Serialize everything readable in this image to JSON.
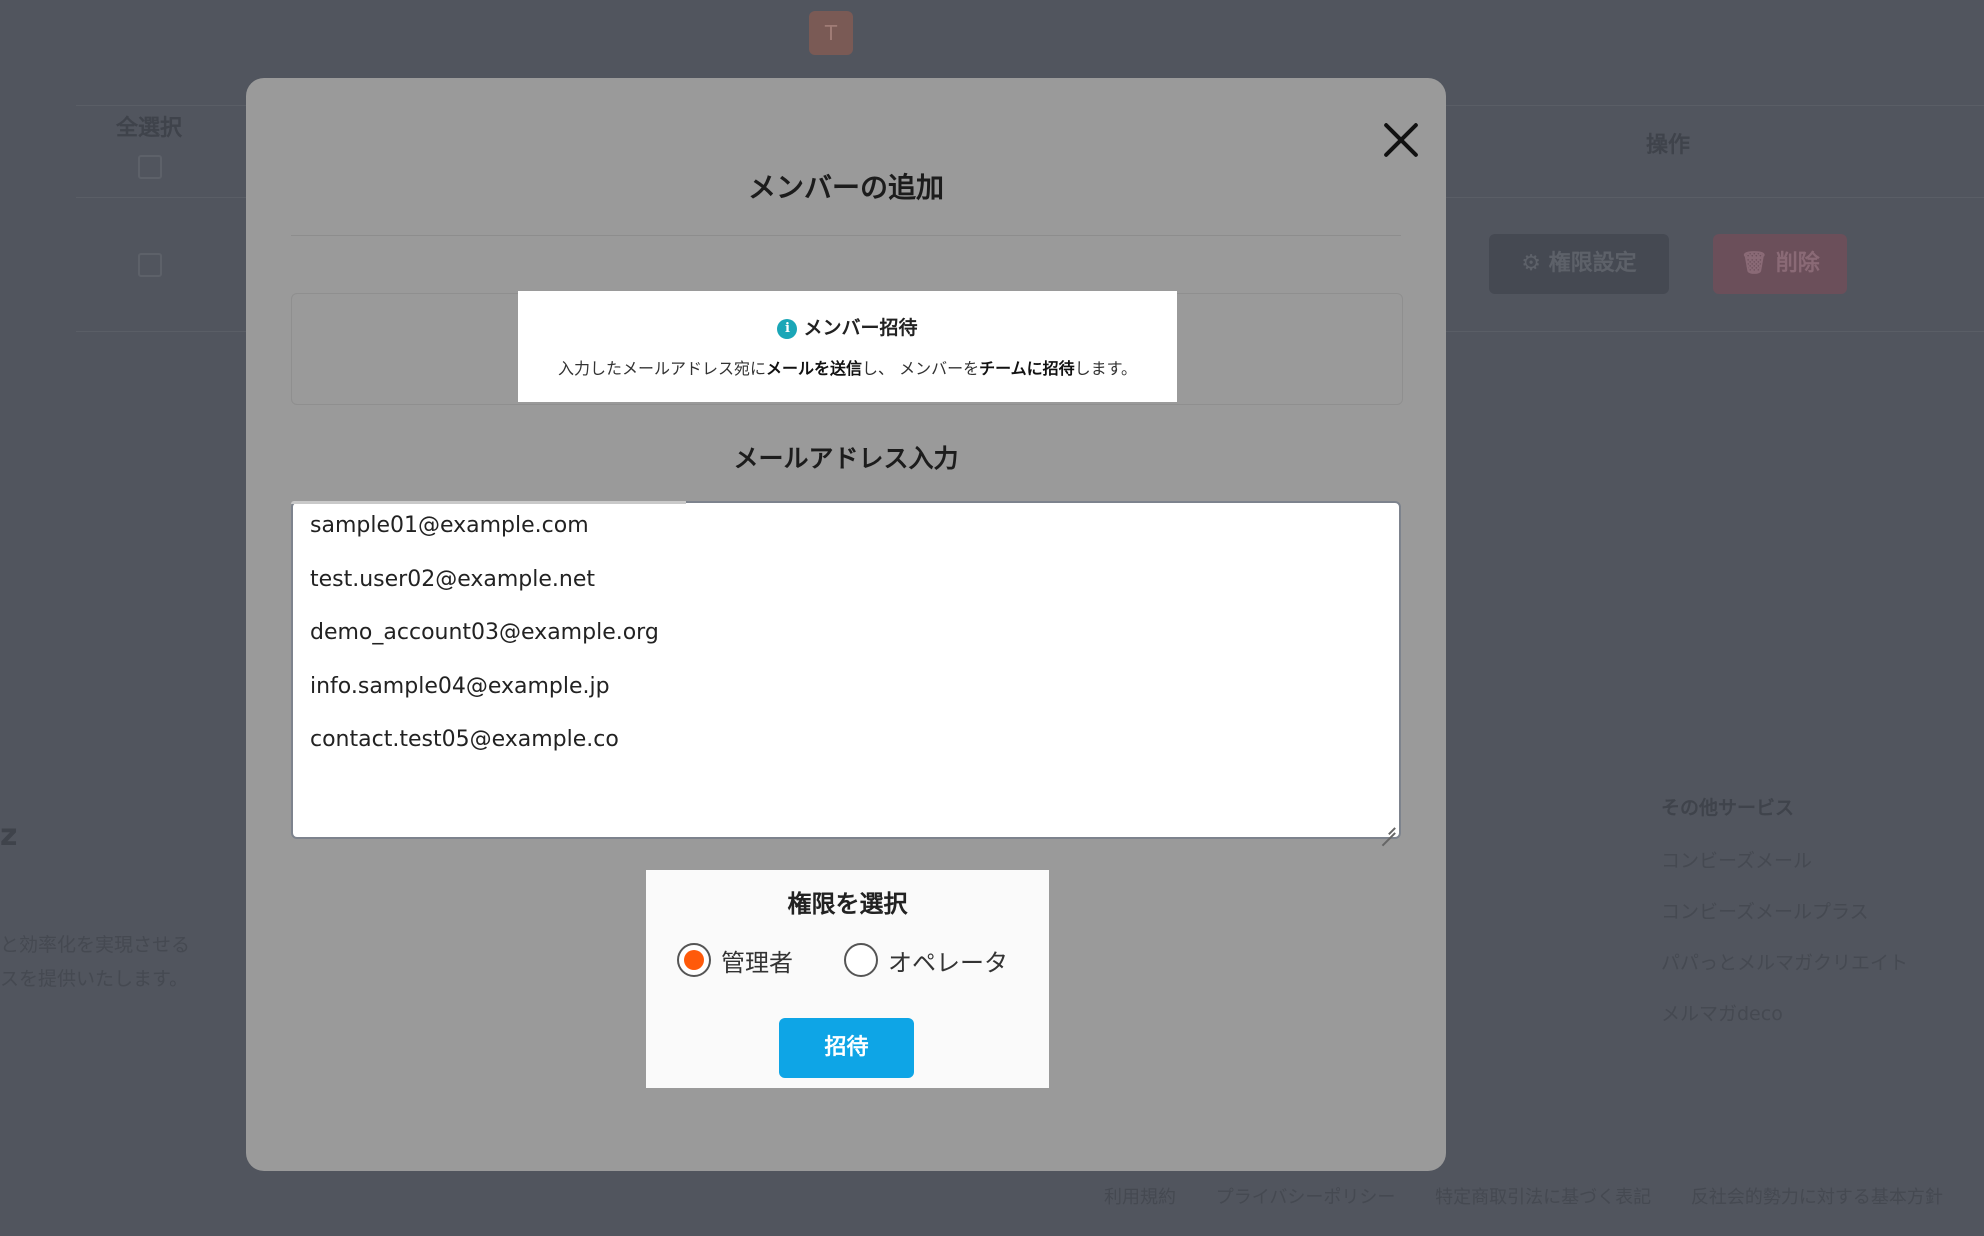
{
  "background": {
    "avatar_letter": "T",
    "select_all_header": "全選択",
    "actions_header": "操作",
    "permission_button": "⚙ 権限設定",
    "delete_button": "🗑 削除",
    "brand_fragment": "z",
    "desc_line1": "と効率化を実現させる",
    "desc_line2": "スを提供いたします。",
    "other_services": {
      "heading": "その他サービス",
      "items": [
        "コンビーズメール",
        "コンビーズメールプラス",
        "パパっとメルマガクリエイト",
        "メルマガdeco"
      ]
    },
    "footer_links": [
      "利用規約",
      "プライバシーポリシー",
      "特定商取引法に基づく表記",
      "反社会的勢力に対する基本方針"
    ]
  },
  "modal": {
    "title": "メンバーの追加",
    "info": {
      "icon": "info-icon",
      "heading": "メンバー招待",
      "desc_part1": "入力したメールアドレス宛に",
      "desc_bold1": "メールを送信",
      "desc_part2": "し、 メンバーを",
      "desc_bold2": "チームに招待",
      "desc_part3": "します。"
    },
    "email_label": "メールアドレス入力",
    "emails": [
      "sample01@example.com",
      "test.user02@example.net",
      "demo_account03@example.org",
      "info.sample04@example.jp",
      "contact.test05@example.co"
    ],
    "role": {
      "title": "権限を選択",
      "options": [
        "管理者",
        "オペレータ"
      ],
      "selected": "管理者"
    },
    "invite_button": "招待",
    "accent_color": "#ff5a0a",
    "button_color": "#0ea5e6"
  }
}
